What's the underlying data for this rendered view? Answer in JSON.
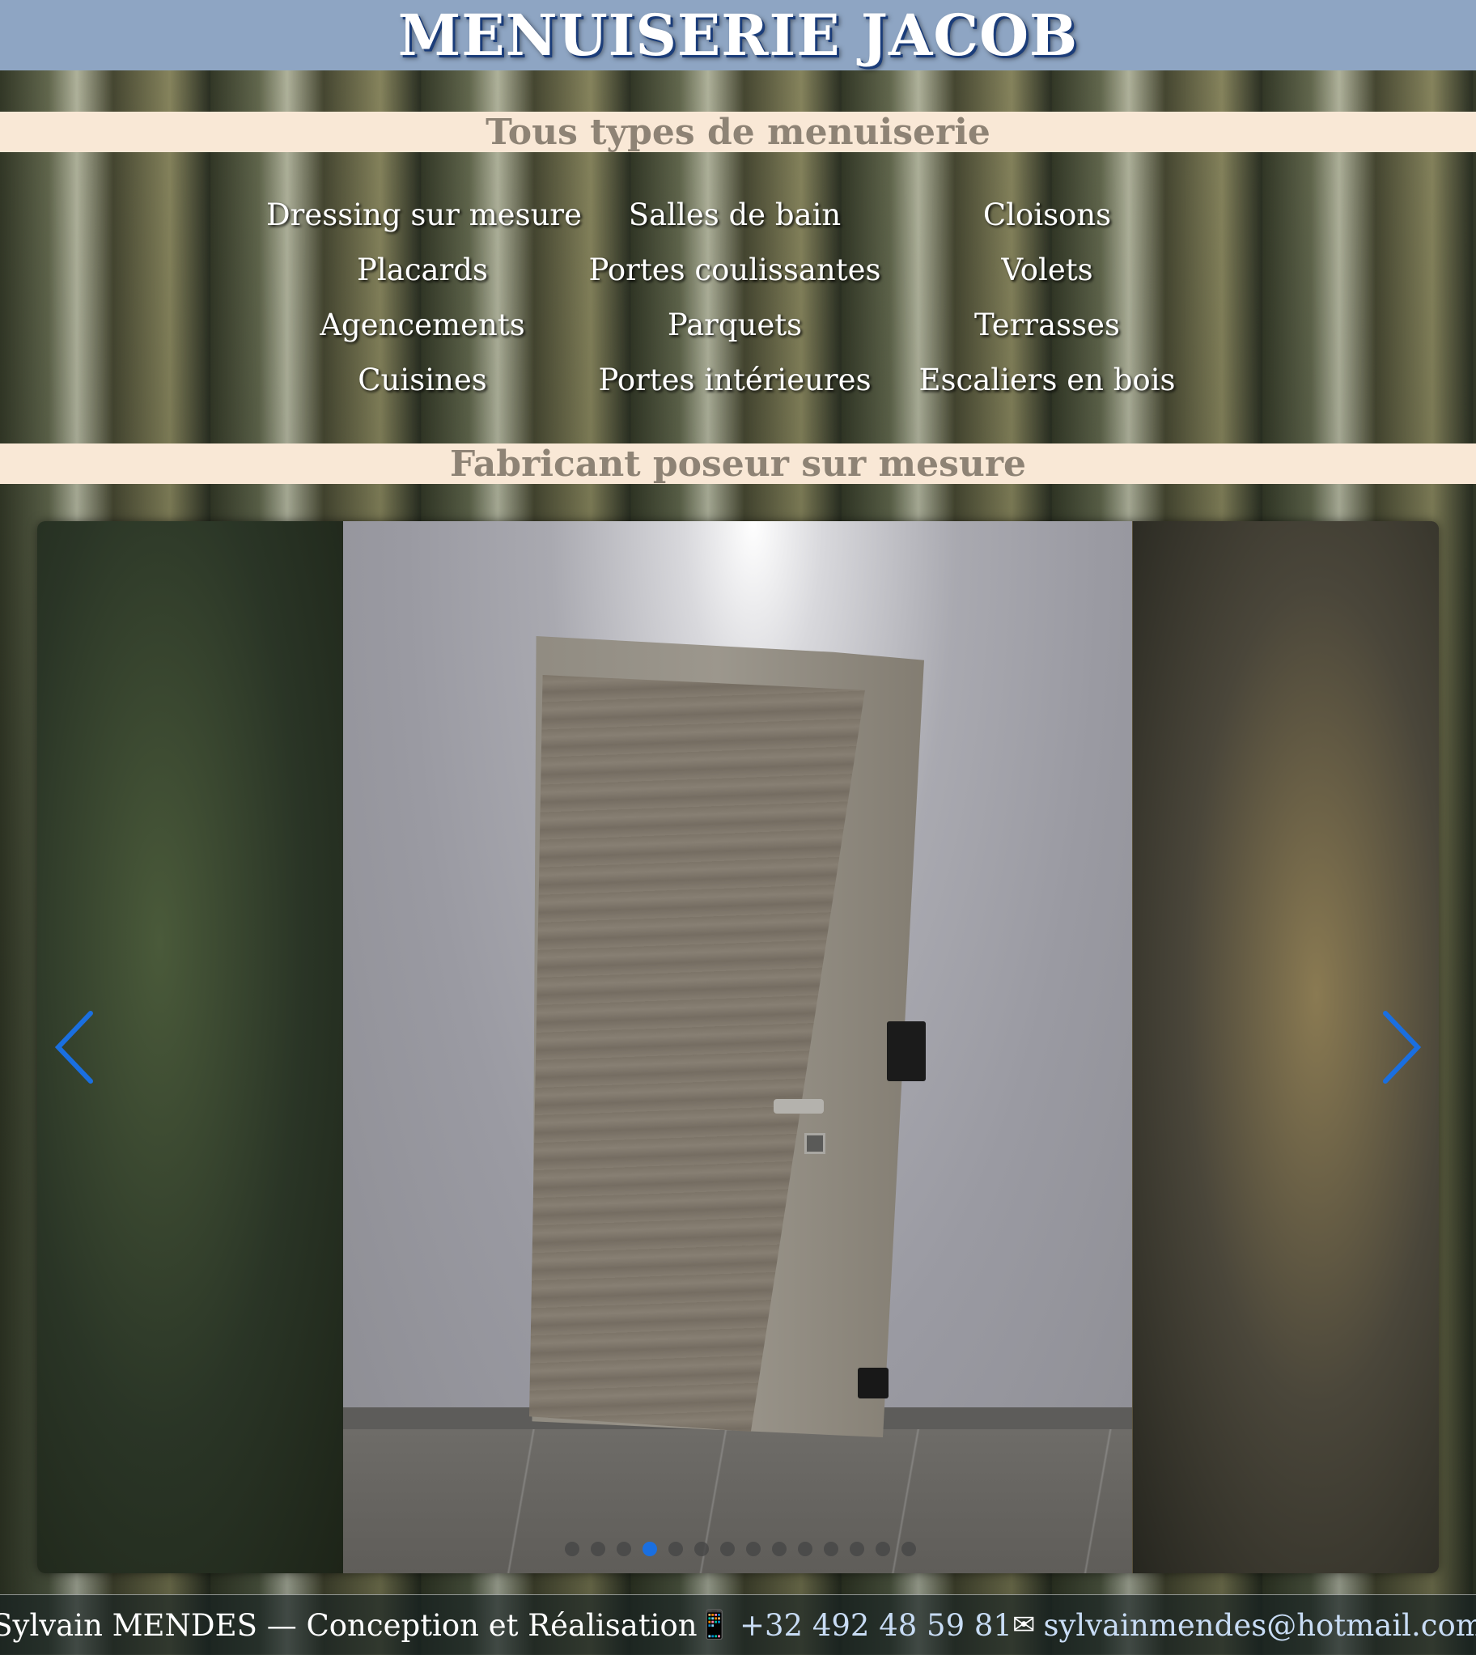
{
  "header": {
    "title": "MENUISERIE JACOB"
  },
  "band1": {
    "text": "Tous types de menuiserie"
  },
  "services": [
    "Dressing sur mesure",
    "Salles de bain",
    "Cloisons",
    "Placards",
    "Portes coulissantes",
    "Volets",
    "Agencements",
    "Parquets",
    "Terrasses",
    "Cuisines",
    "Portes intérieures",
    "Escaliers en bois"
  ],
  "band2": {
    "text": "Fabricant poseur sur mesure"
  },
  "carousel": {
    "prev_icon": "chevron-left-icon",
    "next_icon": "chevron-right-icon",
    "slide_count": 14,
    "active_index": 3,
    "accent_color": "#1a6fe0"
  },
  "footer": {
    "credit": "Sylvain MENDES — Conception et Réalisation",
    "phone_icon": "📱",
    "phone": "+32 492 48 59 81",
    "mail_icon": "✉",
    "email": "sylvainmendes@hotmail.com"
  }
}
